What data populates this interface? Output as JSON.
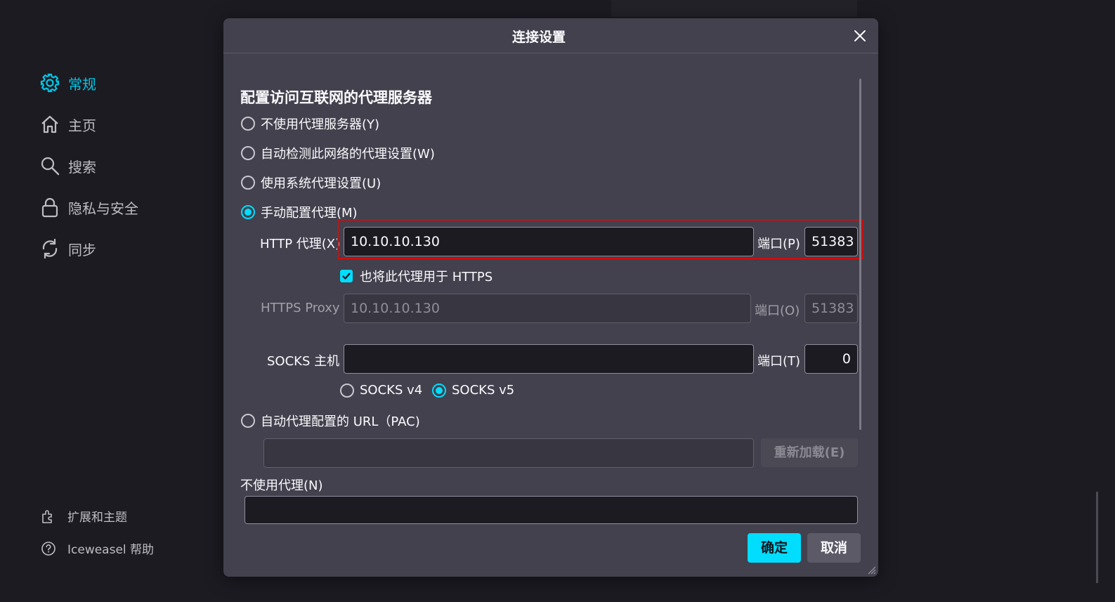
{
  "sidebar": {
    "items": [
      {
        "label": "常规",
        "icon": "gear-icon",
        "active": true
      },
      {
        "label": "主页",
        "icon": "home-icon"
      },
      {
        "label": "搜索",
        "icon": "search-icon"
      },
      {
        "label": "隐私与安全",
        "icon": "lock-icon"
      },
      {
        "label": "同步",
        "icon": "sync-icon"
      }
    ],
    "footer": [
      {
        "label": "扩展和主题",
        "icon": "puzzle-icon"
      },
      {
        "label": "Iceweasel 帮助",
        "icon": "help-icon"
      }
    ]
  },
  "dialog": {
    "title": "连接设置",
    "section_title": "配置访问互联网的代理服务器",
    "options": {
      "no_proxy": "不使用代理服务器(Y)",
      "auto_detect": "自动检测此网络的代理设置(W)",
      "system": "使用系统代理设置(U)",
      "manual": "手动配置代理(M)",
      "pac": "自动代理配置的 URL（PAC)"
    },
    "selected_option": "manual",
    "http": {
      "label": "HTTP 代理(X)",
      "value": "10.10.10.130",
      "port_label": "端口(P)",
      "port": "51383"
    },
    "also_https": {
      "label": "也将此代理用于 HTTPS",
      "checked": true
    },
    "https": {
      "label": "HTTPS Proxy",
      "value": "10.10.10.130",
      "port_label": "端口(O)",
      "port": "51383"
    },
    "socks": {
      "label": "SOCKS 主机",
      "value": "",
      "port_label": "端口(T)",
      "port": "0",
      "v4_label": "SOCKS v4",
      "v5_label": "SOCKS v5",
      "selected_version": "v5"
    },
    "pac_url": "",
    "reload_label": "重新加载(E)",
    "no_proxy_for_label": "不使用代理(N)",
    "no_proxy_for_value": "",
    "ok_label": "确定",
    "cancel_label": "取消"
  },
  "colors": {
    "accent": "#00ddff",
    "highlight_box": "#d00d0d",
    "dialog_bg": "#42414d",
    "page_bg": "#1c1b22"
  }
}
